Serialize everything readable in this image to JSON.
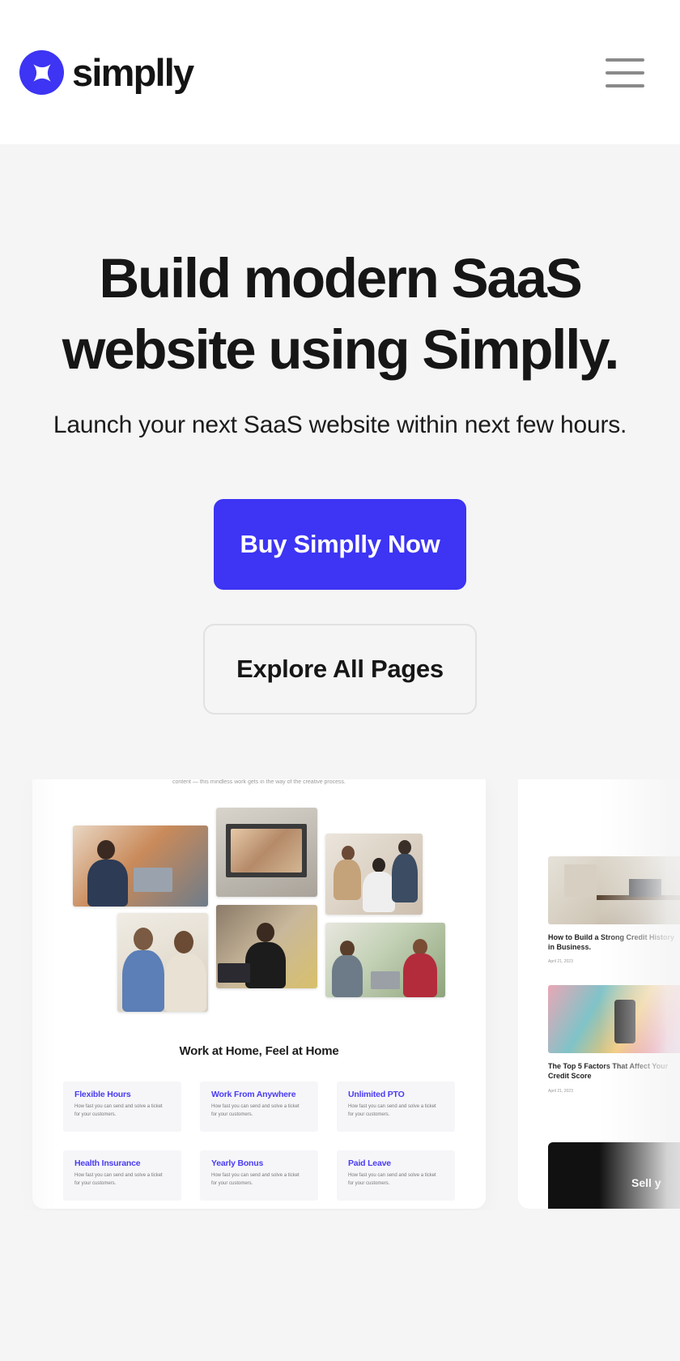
{
  "header": {
    "brand_name": "simplly",
    "logo_icon": "sparkle-logo-icon",
    "menu_icon": "hamburger-menu-icon"
  },
  "hero": {
    "title_line1": "Build modern SaaS",
    "title_line2": "website using Simplly.",
    "subtitle": "Launch your next SaaS website within next few hours."
  },
  "buttons": {
    "primary_label": "Buy Simplly Now",
    "secondary_label": "Explore All Pages"
  },
  "colors": {
    "accent": "#3d34f4",
    "background": "#f5f5f5",
    "text": "#161616"
  },
  "showcase": {
    "main_card": {
      "cut_text": "content — this mindless work gets in the way of the creative process.",
      "heading": "Work at Home, Feel at Home",
      "features": [
        {
          "title": "Flexible Hours",
          "desc": "How fast you can send and solve a ticket for your customers."
        },
        {
          "title": "Work From Anywhere",
          "desc": "How fast you can send and solve a ticket for your customers."
        },
        {
          "title": "Unlimited PTO",
          "desc": "How fast you can send and solve a ticket for your customers."
        },
        {
          "title": "Health Insurance",
          "desc": "How fast you can send and solve a ticket for your customers."
        },
        {
          "title": "Yearly Bonus",
          "desc": "How fast you can send and solve a ticket for your customers."
        },
        {
          "title": "Paid Leave",
          "desc": "How fast you can send and solve a ticket for your customers."
        }
      ]
    },
    "side_card": {
      "posts": [
        {
          "title": "How to Build a Strong Credit History in Business.",
          "date": "April 21, 2023"
        },
        {
          "title": "The Top 5 Factors That Affect Your Credit Score",
          "date": "April 21, 2023"
        }
      ],
      "dark_banner_text": "Sell y"
    }
  }
}
